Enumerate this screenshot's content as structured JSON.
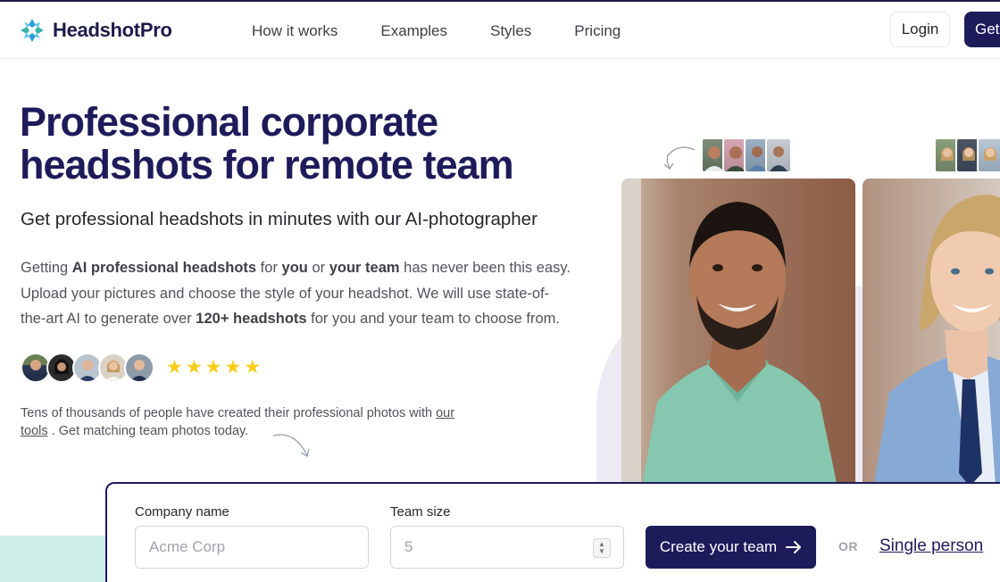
{
  "header": {
    "brand": "HeadshotPro",
    "nav": [
      {
        "label": "How it works"
      },
      {
        "label": "Examples"
      },
      {
        "label": "Styles"
      },
      {
        "label": "Pricing"
      }
    ],
    "login_label": "Login",
    "cta_label": "Get"
  },
  "hero": {
    "title": "Professional corporate headshots for remote team",
    "subtitle": "Get professional headshots in minutes with our AI-photographer",
    "desc": {
      "p1": "Getting ",
      "b1": "AI professional headshots",
      "p2": " for ",
      "b2": "you",
      "p3": " or ",
      "b3": "your team",
      "p4": " has never been this easy. Upload your pictures and choose the style of your headshot. We will use state-of-the-art AI to generate over ",
      "b4": "120+ headshots",
      "p5": " for you and your team to choose from."
    },
    "rating": 5,
    "social_text": "Tens of thousands of people have created their professional photos with ",
    "social_link": "our tools",
    "social_end": " . Get matching team photos today."
  },
  "form": {
    "company_label": "Company name",
    "company_placeholder": "Acme Corp",
    "team_label": "Team size",
    "team_placeholder": "5",
    "create_label": "Create your team",
    "or_label": "OR",
    "single_label": "Single person"
  },
  "colors": {
    "brand_navy": "#1e1b5b",
    "star_yellow": "#facc15",
    "teal_accent": "#cdeee9"
  },
  "icons": {
    "logo": "headshotpro-logo-icon",
    "arrow": "arrow-right-icon",
    "star": "star-icon"
  }
}
